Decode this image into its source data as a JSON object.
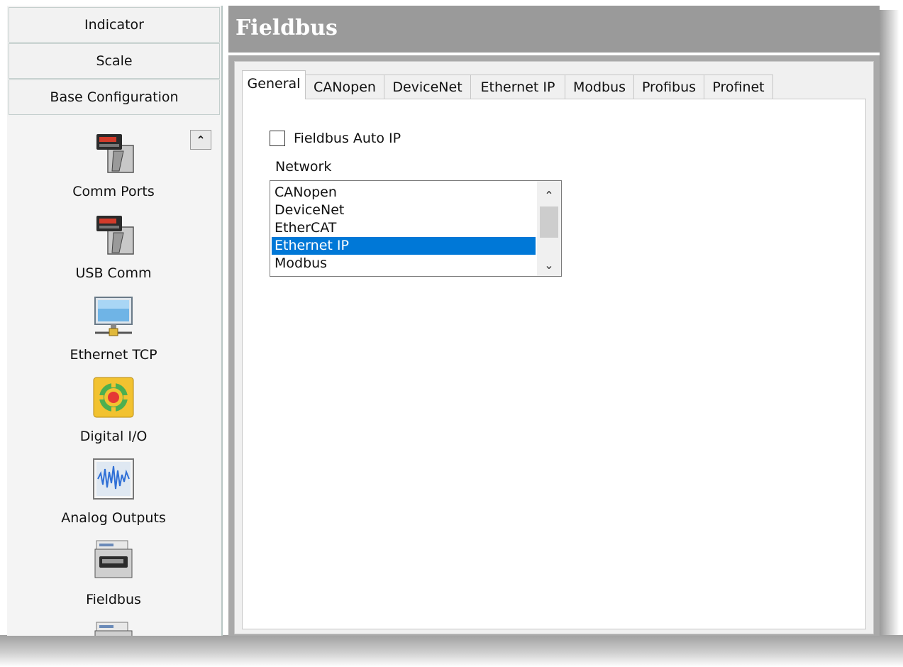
{
  "left_nav": {
    "top_buttons": [
      "Indicator",
      "Scale",
      "Base Configuration"
    ],
    "items": [
      {
        "label": "Comm Ports",
        "icon": "scale-terminal-icon"
      },
      {
        "label": "USB Comm",
        "icon": "scale-terminal-icon"
      },
      {
        "label": "Ethernet TCP",
        "icon": "network-computer-icon"
      },
      {
        "label": "Digital I/O",
        "icon": "digital-io-target-icon"
      },
      {
        "label": "Analog Outputs",
        "icon": "waveform-icon"
      },
      {
        "label": "Fieldbus",
        "icon": "fieldbus-device-icon"
      }
    ]
  },
  "header": {
    "title": "Fieldbus"
  },
  "tabs": [
    "General",
    "CANopen",
    "DeviceNet",
    "Ethernet IP",
    "Modbus",
    "Profibus",
    "Profinet"
  ],
  "active_tab": "General",
  "general": {
    "auto_ip_label": "Fieldbus Auto IP",
    "auto_ip_checked": false,
    "network_label": "Network",
    "network_options": [
      "CANopen",
      "DeviceNet",
      "EtherCAT",
      "Ethernet IP",
      "Modbus"
    ],
    "selected_network": "Ethernet IP"
  },
  "colors": {
    "header_bg": "#9a9a9a",
    "selection": "#0078d7",
    "panel_bg": "#f0f0f0"
  }
}
